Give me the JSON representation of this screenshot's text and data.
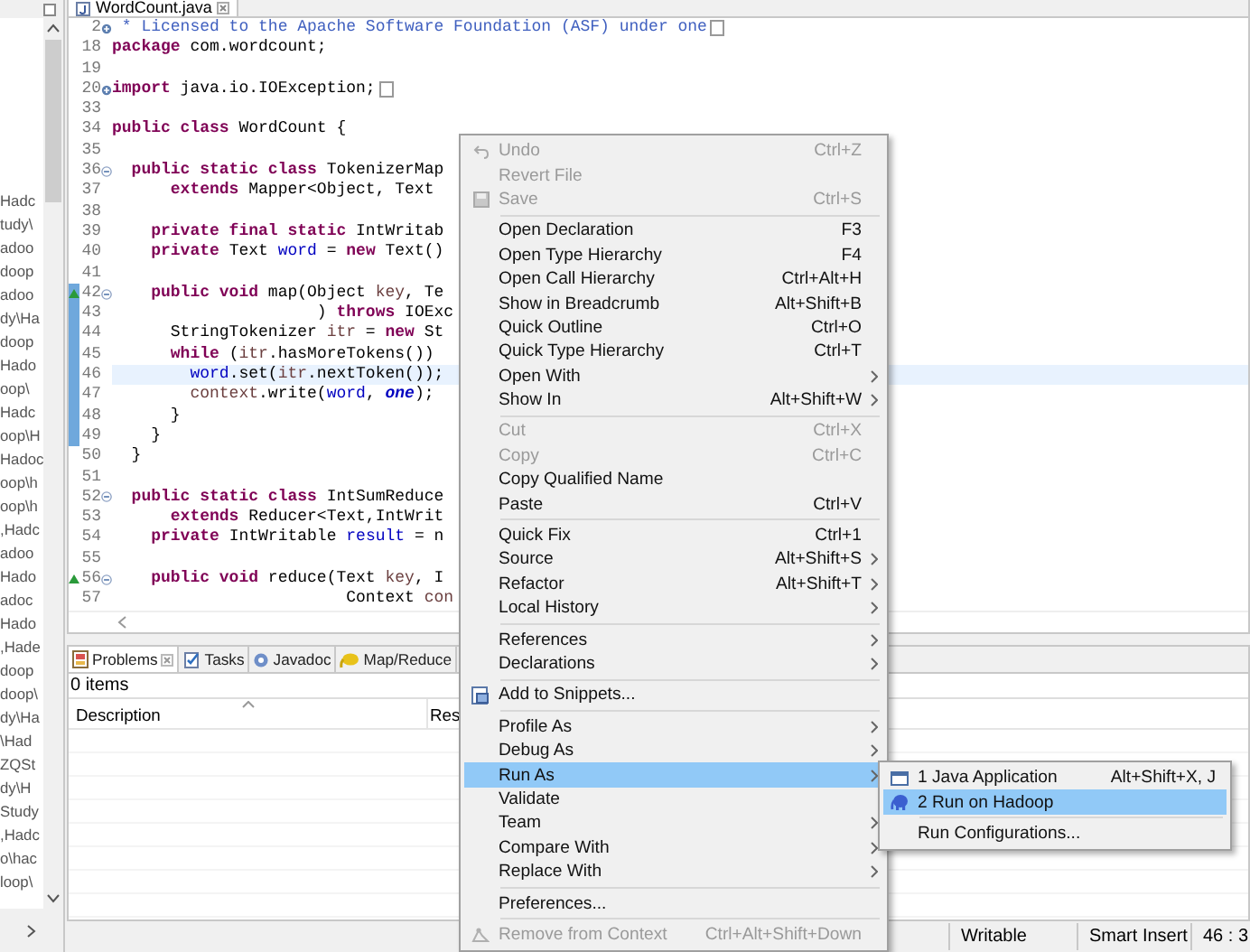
{
  "explorer": {
    "entries": [
      "Hadc",
      "tudy\\",
      "adoo",
      "doop",
      "adoo",
      "dy\\Ha",
      "doop",
      "Hado",
      "oop\\",
      "Hadc",
      "oop\\H",
      "Hadoc",
      "oop\\h",
      "oop\\h",
      ",Hadc",
      "adoo",
      "Hado",
      "adoc",
      "Hado",
      ",Hade",
      "doop",
      "doop\\",
      "dy\\Ha",
      "\\Had",
      "ZQSt",
      "dy\\H",
      "Study",
      ",Hadc",
      "o\\hac",
      "loop\\"
    ]
  },
  "editor": {
    "tab": {
      "title": "WordCount.java",
      "selected": true
    },
    "lines": [
      {
        "number": "2",
        "fold_expanded": false,
        "override": false,
        "changed": false,
        "current": false,
        "tokens": [
          {
            "kind": "comment",
            "text": " * Licensed to the Apache Software Foundation (ASF) under one"
          }
        ]
      },
      {
        "number": "18",
        "override": false,
        "changed": false,
        "current": false,
        "tokens": [
          {
            "kind": "keyword",
            "text": "package"
          },
          {
            "kind": "plain",
            "text": " com.wordcount;"
          }
        ]
      },
      {
        "number": "19",
        "override": false,
        "changed": false,
        "current": false
      },
      {
        "number": "20",
        "fold_expanded": false,
        "override": false,
        "changed": false,
        "current": false,
        "tokens": [
          {
            "kind": "keyword",
            "text": "import"
          },
          {
            "kind": "plain",
            "text": " java.io.IOException;"
          }
        ]
      },
      {
        "number": "33",
        "override": false,
        "changed": false,
        "current": false
      },
      {
        "number": "34",
        "override": false,
        "changed": false,
        "current": false,
        "tokens": [
          {
            "kind": "keyword",
            "text": "public class"
          },
          {
            "kind": "plain",
            "text": " WordCount {"
          }
        ]
      },
      {
        "number": "35",
        "override": false,
        "changed": false,
        "current": false
      },
      {
        "number": "36",
        "fold_expanded": true,
        "override": false,
        "changed": false,
        "current": false,
        "tokens": [
          {
            "kind": "keyword",
            "text": "  public static class"
          },
          {
            "kind": "plain",
            "text": " TokenizerMap"
          }
        ]
      },
      {
        "number": "37",
        "override": false,
        "changed": false,
        "current": false,
        "tokens": [
          {
            "kind": "keyword",
            "text": "      extends"
          },
          {
            "kind": "plain",
            "text": " Mapper<Object, Text"
          }
        ]
      },
      {
        "number": "38",
        "override": false,
        "changed": false,
        "current": false
      },
      {
        "number": "39",
        "override": false,
        "changed": false,
        "current": false,
        "tokens": [
          {
            "kind": "keyword",
            "text": "    private final static"
          },
          {
            "kind": "plain",
            "text": " IntWritab"
          }
        ]
      },
      {
        "number": "40",
        "override": false,
        "changed": false,
        "current": false,
        "tokens": [
          {
            "kind": "keyword",
            "text": "    private"
          },
          {
            "kind": "plain",
            "text": " Text "
          },
          {
            "kind": "field",
            "text": "word"
          },
          {
            "kind": "plain",
            "text": " = "
          },
          {
            "kind": "keyword",
            "text": "new"
          },
          {
            "kind": "plain",
            "text": " Text()"
          }
        ]
      },
      {
        "number": "41",
        "override": false,
        "changed": false,
        "current": false
      },
      {
        "number": "42",
        "fold_expanded": true,
        "override": true,
        "changed": true,
        "current": false,
        "tokens": [
          {
            "kind": "keyword",
            "text": "    public void"
          },
          {
            "kind": "plain",
            "text": " map(Object "
          },
          {
            "kind": "variable",
            "text": "key"
          },
          {
            "kind": "plain",
            "text": ", Te"
          }
        ]
      },
      {
        "number": "43",
        "override": false,
        "changed": true,
        "current": false,
        "tokens": [
          {
            "kind": "plain",
            "text": "                     ) "
          },
          {
            "kind": "keyword",
            "text": "throws"
          },
          {
            "kind": "plain",
            "text": " IOExc"
          }
        ]
      },
      {
        "number": "44",
        "override": false,
        "changed": true,
        "current": false,
        "tokens": [
          {
            "kind": "plain",
            "text": "      StringTokenizer "
          },
          {
            "kind": "variable",
            "text": "itr"
          },
          {
            "kind": "plain",
            "text": " = "
          },
          {
            "kind": "keyword",
            "text": "new"
          },
          {
            "kind": "plain",
            "text": " St"
          }
        ]
      },
      {
        "number": "45",
        "override": false,
        "changed": true,
        "current": false,
        "tokens": [
          {
            "kind": "keyword",
            "text": "      while"
          },
          {
            "kind": "plain",
            "text": " ("
          },
          {
            "kind": "variable",
            "text": "itr"
          },
          {
            "kind": "plain",
            "text": ".hasMoreTokens())"
          }
        ]
      },
      {
        "number": "46",
        "override": false,
        "changed": true,
        "current": true,
        "tokens": [
          {
            "kind": "field",
            "text": "        word"
          },
          {
            "kind": "plain",
            "text": ".set("
          },
          {
            "kind": "variable",
            "text": "itr"
          },
          {
            "kind": "plain",
            "text": ".nextToken());"
          }
        ]
      },
      {
        "number": "47",
        "override": false,
        "changed": true,
        "current": false,
        "tokens": [
          {
            "kind": "variable",
            "text": "        context"
          },
          {
            "kind": "plain",
            "text": ".write("
          },
          {
            "kind": "field",
            "text": "word"
          },
          {
            "kind": "plain",
            "text": ", "
          },
          {
            "kind": "constant",
            "text": "one"
          },
          {
            "kind": "plain",
            "text": ");"
          }
        ]
      },
      {
        "number": "48",
        "override": false,
        "changed": true,
        "current": false,
        "tokens": [
          {
            "kind": "plain",
            "text": "      }"
          }
        ]
      },
      {
        "number": "49",
        "override": false,
        "changed": true,
        "current": false,
        "tokens": [
          {
            "kind": "plain",
            "text": "    }"
          }
        ]
      },
      {
        "number": "50",
        "override": false,
        "changed": false,
        "current": false,
        "tokens": [
          {
            "kind": "plain",
            "text": "  }"
          }
        ]
      },
      {
        "number": "51",
        "override": false,
        "changed": false,
        "current": false
      },
      {
        "number": "52",
        "fold_expanded": true,
        "override": false,
        "changed": false,
        "current": false,
        "tokens": [
          {
            "kind": "keyword",
            "text": "  public static class"
          },
          {
            "kind": "plain",
            "text": " IntSumReduce"
          }
        ]
      },
      {
        "number": "53",
        "override": false,
        "changed": false,
        "current": false,
        "tokens": [
          {
            "kind": "keyword",
            "text": "      extends"
          },
          {
            "kind": "plain",
            "text": " Reducer<Text,IntWrit"
          }
        ]
      },
      {
        "number": "54",
        "override": false,
        "changed": false,
        "current": false,
        "tokens": [
          {
            "kind": "keyword",
            "text": "    private"
          },
          {
            "kind": "plain",
            "text": " IntWritable "
          },
          {
            "kind": "field",
            "text": "result"
          },
          {
            "kind": "plain",
            "text": " = n"
          }
        ]
      },
      {
        "number": "55",
        "override": false,
        "changed": false,
        "current": false
      },
      {
        "number": "56",
        "fold_expanded": true,
        "override": true,
        "changed": false,
        "current": false,
        "tokens": [
          {
            "kind": "keyword",
            "text": "    public void"
          },
          {
            "kind": "plain",
            "text": " reduce(Text "
          },
          {
            "kind": "variable",
            "text": "key"
          },
          {
            "kind": "plain",
            "text": ", I"
          }
        ]
      },
      {
        "number": "57",
        "override": false,
        "changed": false,
        "current": false,
        "tokens": [
          {
            "kind": "plain",
            "text": "                        Context "
          },
          {
            "kind": "variable",
            "text": "con"
          }
        ]
      }
    ]
  },
  "bottom_panel": {
    "tabs": [
      {
        "label": "Problems",
        "selected": true,
        "closable": true
      },
      {
        "label": "Tasks",
        "selected": false,
        "closable": false
      },
      {
        "label": "Javadoc",
        "selected": false,
        "closable": false
      },
      {
        "label": "Map/Reduce",
        "selected": false,
        "closable": false
      }
    ],
    "summary": "0 items",
    "columns": [
      "Description",
      "Res"
    ]
  },
  "status_bar": [
    "Writable",
    "Smart Insert",
    "46 : 3"
  ],
  "context_menu": {
    "items": [
      {
        "kind": "item",
        "label": "Undo",
        "shortcut": "Ctrl+Z",
        "disabled": true,
        "selected": false,
        "submenu": false
      },
      {
        "kind": "item",
        "label": "Revert File",
        "disabled": true,
        "selected": false,
        "submenu": false
      },
      {
        "kind": "item",
        "label": "Save",
        "shortcut": "Ctrl+S",
        "disabled": true,
        "selected": false,
        "submenu": false
      },
      {
        "kind": "separator"
      },
      {
        "kind": "item",
        "label": "Open Declaration",
        "shortcut": "F3",
        "disabled": false,
        "selected": false,
        "submenu": false
      },
      {
        "kind": "item",
        "label": "Open Type Hierarchy",
        "shortcut": "F4",
        "disabled": false,
        "selected": false,
        "submenu": false
      },
      {
        "kind": "item",
        "label": "Open Call Hierarchy",
        "shortcut": "Ctrl+Alt+H",
        "disabled": false,
        "selected": false,
        "submenu": false
      },
      {
        "kind": "item",
        "label": "Show in Breadcrumb",
        "shortcut": "Alt+Shift+B",
        "disabled": false,
        "selected": false,
        "submenu": false
      },
      {
        "kind": "item",
        "label": "Quick Outline",
        "shortcut": "Ctrl+O",
        "disabled": false,
        "selected": false,
        "submenu": false
      },
      {
        "kind": "item",
        "label": "Quick Type Hierarchy",
        "shortcut": "Ctrl+T",
        "disabled": false,
        "selected": false,
        "submenu": false
      },
      {
        "kind": "item",
        "label": "Open With",
        "disabled": false,
        "selected": false,
        "submenu": true
      },
      {
        "kind": "item",
        "label": "Show In",
        "shortcut": "Alt+Shift+W",
        "disabled": false,
        "selected": false,
        "submenu": true
      },
      {
        "kind": "separator"
      },
      {
        "kind": "item",
        "label": "Cut",
        "shortcut": "Ctrl+X",
        "disabled": true,
        "selected": false,
        "submenu": false
      },
      {
        "kind": "item",
        "label": "Copy",
        "shortcut": "Ctrl+C",
        "disabled": true,
        "selected": false,
        "submenu": false
      },
      {
        "kind": "item",
        "label": "Copy Qualified Name",
        "disabled": false,
        "selected": false,
        "submenu": false
      },
      {
        "kind": "item",
        "label": "Paste",
        "shortcut": "Ctrl+V",
        "disabled": false,
        "selected": false,
        "submenu": false
      },
      {
        "kind": "separator"
      },
      {
        "kind": "item",
        "label": "Quick Fix",
        "shortcut": "Ctrl+1",
        "disabled": false,
        "selected": false,
        "submenu": false
      },
      {
        "kind": "item",
        "label": "Source",
        "shortcut": "Alt+Shift+S",
        "disabled": false,
        "selected": false,
        "submenu": true
      },
      {
        "kind": "item",
        "label": "Refactor",
        "shortcut": "Alt+Shift+T",
        "disabled": false,
        "selected": false,
        "submenu": true
      },
      {
        "kind": "item",
        "label": "Local History",
        "disabled": false,
        "selected": false,
        "submenu": true
      },
      {
        "kind": "separator"
      },
      {
        "kind": "item",
        "label": "References",
        "disabled": false,
        "selected": false,
        "submenu": true
      },
      {
        "kind": "item",
        "label": "Declarations",
        "disabled": false,
        "selected": false,
        "submenu": true
      },
      {
        "kind": "separator"
      },
      {
        "kind": "item",
        "label": "Add to Snippets...",
        "disabled": false,
        "selected": false,
        "submenu": false
      },
      {
        "kind": "separator"
      },
      {
        "kind": "item",
        "label": "Profile As",
        "disabled": false,
        "selected": false,
        "submenu": true
      },
      {
        "kind": "item",
        "label": "Debug As",
        "disabled": false,
        "selected": false,
        "submenu": true
      },
      {
        "kind": "item",
        "label": "Run As",
        "disabled": false,
        "selected": true,
        "submenu": true
      },
      {
        "kind": "item",
        "label": "Validate",
        "disabled": false,
        "selected": false,
        "submenu": false
      },
      {
        "kind": "item",
        "label": "Team",
        "disabled": false,
        "selected": false,
        "submenu": true
      },
      {
        "kind": "item",
        "label": "Compare With",
        "disabled": false,
        "selected": false,
        "submenu": true
      },
      {
        "kind": "item",
        "label": "Replace With",
        "disabled": false,
        "selected": false,
        "submenu": true
      },
      {
        "kind": "separator"
      },
      {
        "kind": "item",
        "label": "Preferences...",
        "disabled": false,
        "selected": false,
        "submenu": false
      },
      {
        "kind": "separator"
      },
      {
        "kind": "item",
        "label": "Remove from Context",
        "shortcut": "Ctrl+Alt+Shift+Down",
        "disabled": true,
        "selected": false,
        "submenu": false
      }
    ]
  },
  "run_as_submenu": {
    "items": [
      {
        "kind": "item",
        "label": "1 Java Application",
        "shortcut": "Alt+Shift+X, J",
        "selected": false
      },
      {
        "kind": "item",
        "label": "2 Run on Hadoop",
        "selected": true
      },
      {
        "kind": "separator"
      },
      {
        "kind": "item",
        "label": "Run Configurations...",
        "selected": false
      }
    ]
  }
}
